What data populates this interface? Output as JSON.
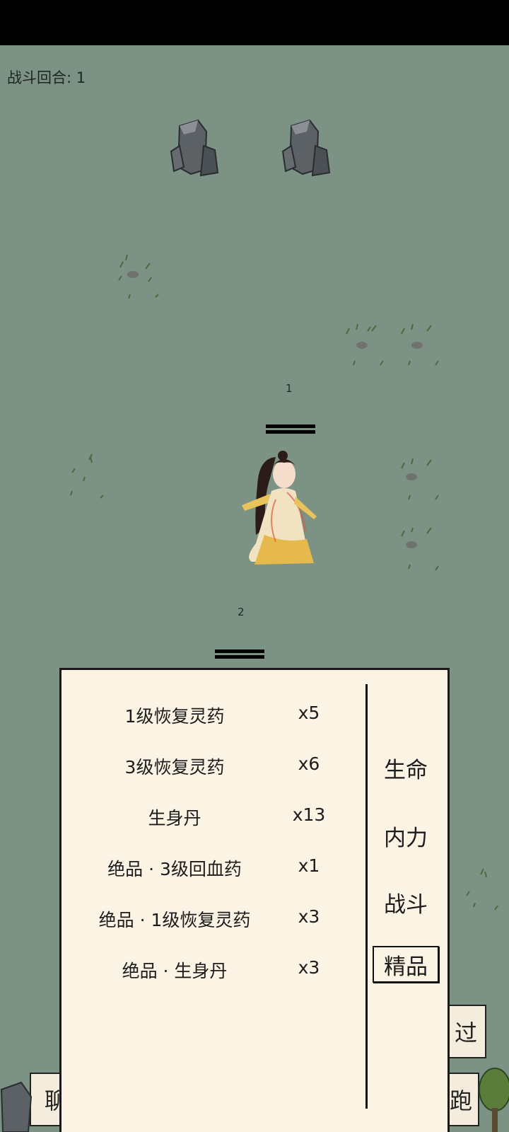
{
  "hud": {
    "round_label": "战斗回合: 1"
  },
  "markers": [
    {
      "number": "1"
    },
    {
      "number": "2"
    }
  ],
  "buttons": {
    "skip_label": "过",
    "flee_label": "跑",
    "chat_label": "聊"
  },
  "item_panel": {
    "items": [
      {
        "name": "1级恢复灵药",
        "count": "x5"
      },
      {
        "name": "3级恢复灵药",
        "count": "x6"
      },
      {
        "name": "生身丹",
        "count": "x13"
      },
      {
        "name": "绝品 · 3级回血药",
        "count": "x1"
      },
      {
        "name": "绝品 · 1级恢复灵药",
        "count": "x3"
      },
      {
        "name": "绝品 · 生身丹",
        "count": "x3"
      }
    ],
    "tabs": [
      {
        "label": "生命",
        "active": false
      },
      {
        "label": "内力",
        "active": false
      },
      {
        "label": "战斗",
        "active": false
      },
      {
        "label": "精品",
        "active": true
      }
    ]
  },
  "colors": {
    "background": "#7b9284",
    "panel": "#fbf3e4",
    "border": "#1a1a1a"
  }
}
